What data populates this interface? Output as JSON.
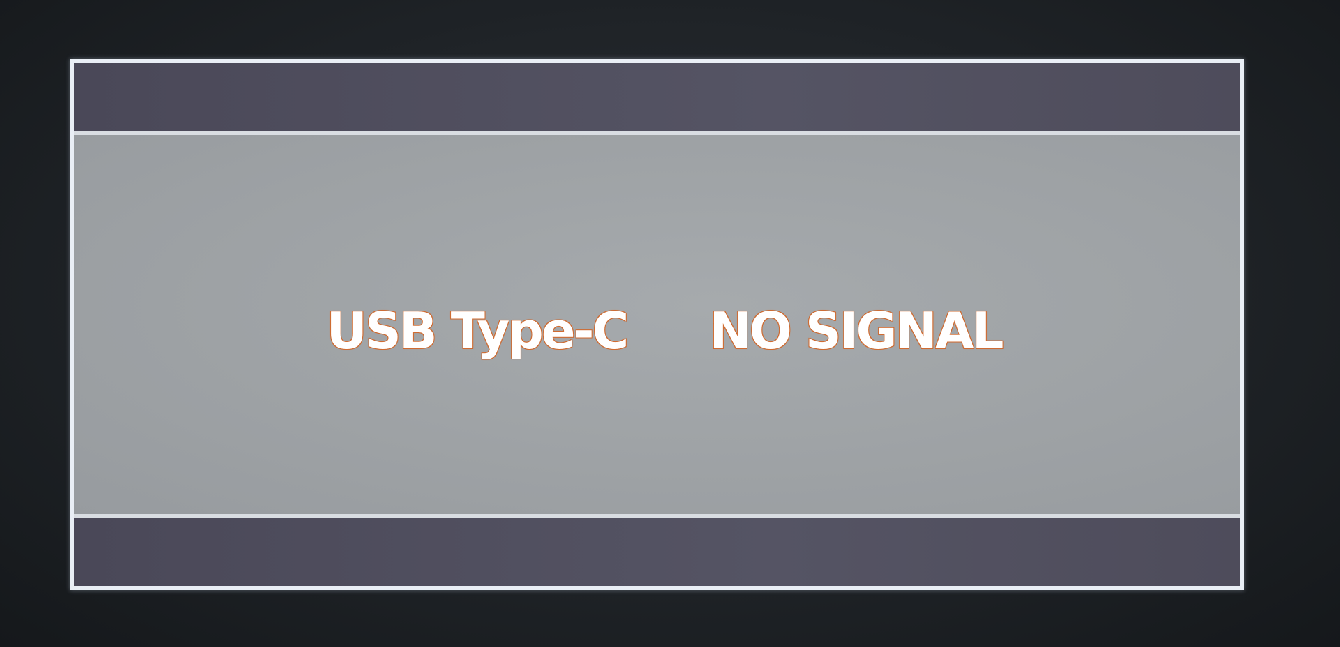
{
  "osd": {
    "input_source": "USB Type-C",
    "status": "NO SIGNAL"
  },
  "colors": {
    "frame_border": "#e9eef5",
    "band_fill": "#4f4d5c",
    "panel_fill": "#9ea2a5",
    "text": "#ffffff",
    "text_glow": "#e07a3a"
  }
}
